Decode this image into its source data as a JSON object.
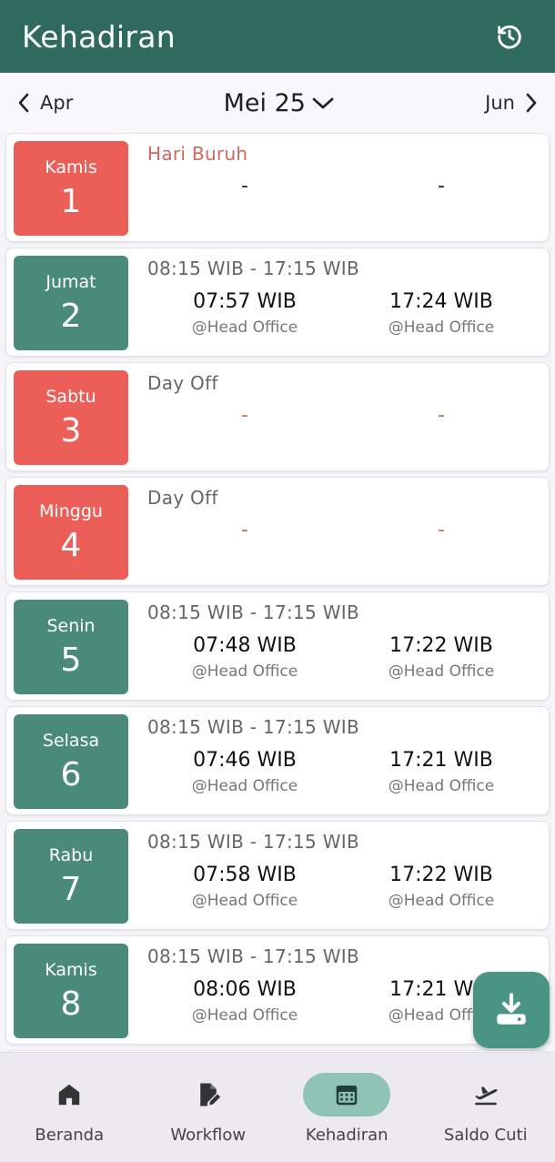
{
  "app": {
    "title": "Kehadiran",
    "history_icon": "history-icon"
  },
  "month_nav": {
    "prev": "Apr",
    "current": "Mei 25",
    "next": "Jun"
  },
  "days": [
    {
      "day": "Kamis",
      "num": "1",
      "color": "red",
      "schedule": "Hari Buruh",
      "schedule_type": "holiday",
      "in_time": "-",
      "in_place": "",
      "out_time": "-",
      "out_place": "",
      "dash_color": "dark"
    },
    {
      "day": "Jumat",
      "num": "2",
      "color": "green",
      "schedule": "08:15 WIB - 17:15 WIB",
      "schedule_type": "normal",
      "in_time": "07:57 WIB",
      "in_place": "@Head Office",
      "out_time": "17:24 WIB",
      "out_place": "@Head Office"
    },
    {
      "day": "Sabtu",
      "num": "3",
      "color": "red",
      "schedule": "Day Off",
      "schedule_type": "normal",
      "in_time": "-",
      "in_place": "",
      "out_time": "-",
      "out_place": "",
      "dash_color": "red"
    },
    {
      "day": "Minggu",
      "num": "4",
      "color": "red",
      "schedule": "Day Off",
      "schedule_type": "normal",
      "in_time": "-",
      "in_place": "",
      "out_time": "-",
      "out_place": "",
      "dash_color": "red"
    },
    {
      "day": "Senin",
      "num": "5",
      "color": "green",
      "schedule": "08:15 WIB - 17:15 WIB",
      "schedule_type": "normal",
      "in_time": "07:48 WIB",
      "in_place": "@Head Office",
      "out_time": "17:22 WIB",
      "out_place": "@Head Office"
    },
    {
      "day": "Selasa",
      "num": "6",
      "color": "green",
      "schedule": "08:15 WIB - 17:15 WIB",
      "schedule_type": "normal",
      "in_time": "07:46 WIB",
      "in_place": "@Head Office",
      "out_time": "17:21 WIB",
      "out_place": "@Head Office"
    },
    {
      "day": "Rabu",
      "num": "7",
      "color": "green",
      "schedule": "08:15 WIB - 17:15 WIB",
      "schedule_type": "normal",
      "in_time": "07:58 WIB",
      "in_place": "@Head Office",
      "out_time": "17:22 WIB",
      "out_place": "@Head Office"
    },
    {
      "day": "Kamis",
      "num": "8",
      "color": "green",
      "schedule": "08:15 WIB - 17:15 WIB",
      "schedule_type": "normal",
      "in_time": "08:06 WIB",
      "in_place": "@Head Office",
      "out_time": "17:21 WIB",
      "out_place": "@Head Office"
    }
  ],
  "fab": {
    "icon": "download-icon"
  },
  "bottom_nav": [
    {
      "label": "Beranda",
      "icon": "home-icon",
      "active": false
    },
    {
      "label": "Workflow",
      "icon": "document-edit-icon",
      "active": false
    },
    {
      "label": "Kehadiran",
      "icon": "calendar-icon",
      "active": true
    },
    {
      "label": "Saldo Cuti",
      "icon": "plane-departure-icon",
      "active": false
    }
  ],
  "colors": {
    "primary": "#2e6b5e",
    "green_box": "#4a8a7a",
    "red_box": "#eb5f58",
    "holiday_text": "#d4665f",
    "fab": "#4a9484",
    "nav_active": "#8fc3b3"
  }
}
